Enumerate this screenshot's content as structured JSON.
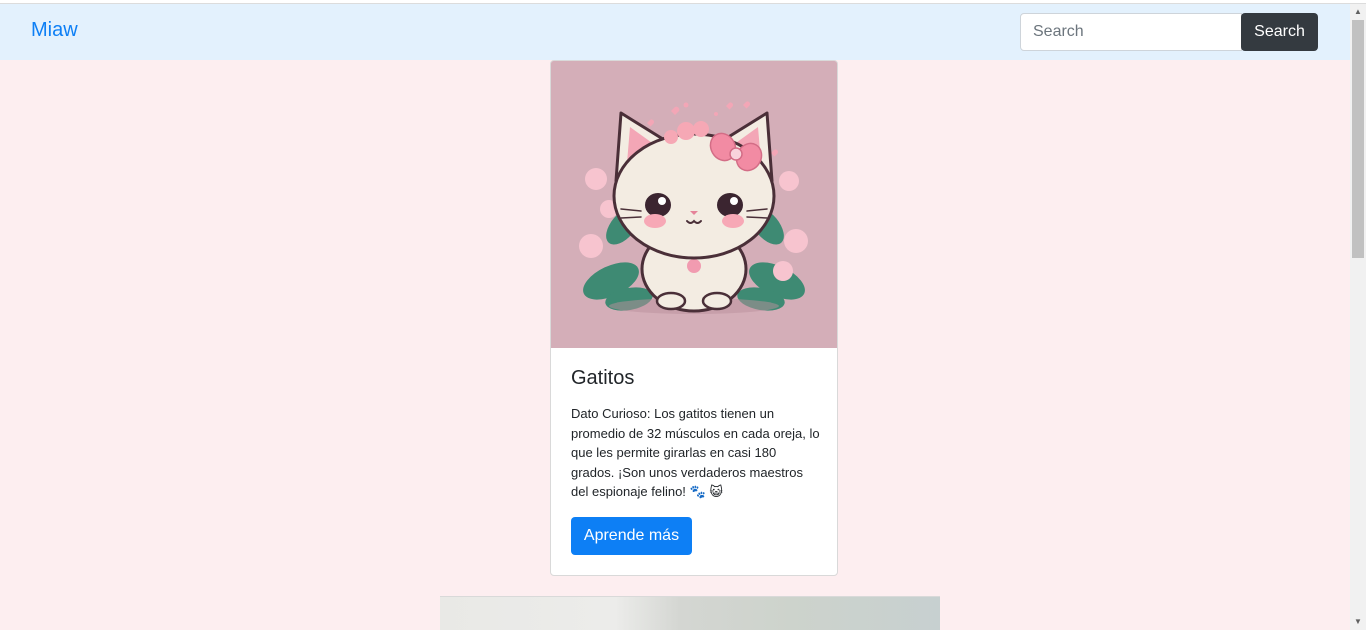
{
  "navbar": {
    "brand": "Miaw",
    "search_placeholder": "Search",
    "search_button": "Search"
  },
  "card": {
    "image_alt": "Gatito kawaii con flores",
    "title": "Gatitos",
    "text": "Dato Curioso: Los gatitos tienen un promedio de 32 músculos en cada oreja, lo que les permite girarlas en casi 180 grados. ¡Son unos verdaderos maestros del espionaje felino! 🐾 😺",
    "button": "Aprende más"
  },
  "colors": {
    "page_background": "#fdeef0",
    "navbar_background": "#e3f1fd",
    "brand": "#0d7ff5",
    "primary_button": "#0d7ff5",
    "dark_button": "#343a40",
    "image_background": "#d4aeb8"
  },
  "icons": {
    "scroll_up": "▲",
    "scroll_down": "▼"
  }
}
